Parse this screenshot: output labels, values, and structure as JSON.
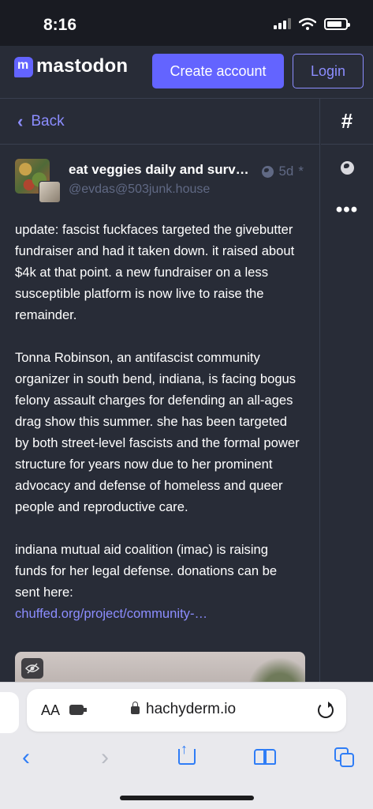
{
  "status_bar": {
    "time": "8:16",
    "icons": [
      "cellular-signal-icon",
      "wifi-icon",
      "battery-icon"
    ]
  },
  "header": {
    "logo_text": "mastodon",
    "create_account_label": "Create account",
    "login_label": "Login"
  },
  "nav": {
    "back_label": "Back"
  },
  "post": {
    "display_name": "eat veggies daily and survi…",
    "handle": "@evdas@503junk.house",
    "time": "5d",
    "time_suffix": "*",
    "paragraphs": [
      "update: fascist fuckfaces targeted the givebutter fundraiser and had it taken down. it raised about $4k at that point. a new fundraiser on a less susceptible platform is now live to raise the remainder.",
      "Tonna Robinson, an antifascist community organizer in south bend, indiana, is facing bogus felony assault charges for defending an all-ages drag show this summer. she has been targeted by both street-level fascists and the formal power structure for years now due to her prominent advocacy and defense of homeless and queer people and reproductive care.",
      "indiana mutual aid coalition (imac) is raising funds for her legal defense. donations can be sent here:"
    ],
    "link_text": "chuffed.org/project/community-…"
  },
  "side_column": {
    "items": [
      "hashtag-icon",
      "globe-icon",
      "more-icon"
    ],
    "hash_glyph": "#",
    "more_glyph": "•••"
  },
  "safari": {
    "aa_label": "AA",
    "url": "hachyderm.io"
  },
  "colors": {
    "background": "#282c37",
    "accent": "#6364ff",
    "link": "#8c8dff",
    "muted": "#606984"
  }
}
